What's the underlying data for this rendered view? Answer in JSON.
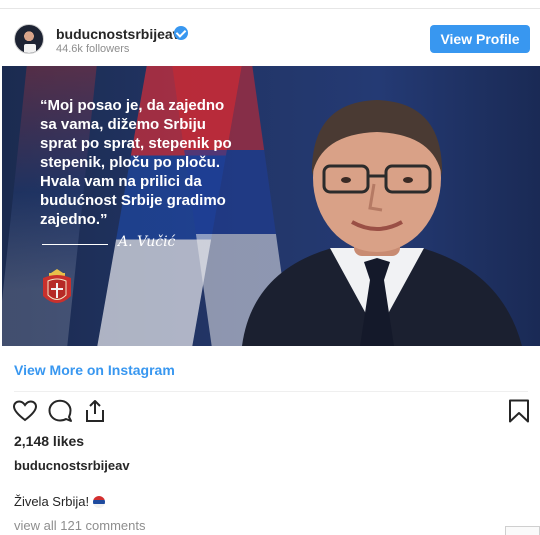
{
  "header": {
    "username": "buducnostsrbijeav",
    "followers": "44.6k followers",
    "view_profile_label": "View Profile",
    "verified_color": "#3897f0"
  },
  "post": {
    "quote_lines": [
      "“Moj posao je, da zajedno",
      "sa vama, dižemo Srbiju",
      "sprat po sprat, stepenik po",
      "stepenik, ploču po ploču.",
      "Hvala vam na prilici da",
      "budućnost Srbije gradimo",
      "zajedno.”"
    ],
    "signature": "A. Vučić",
    "view_more_label": "View More on Instagram",
    "likes": "2,148 likes",
    "caption_user": "buducnostsrbijeav",
    "caption_text": "Živela Srbija!",
    "comments_link": "view all 121 comments"
  },
  "icons": {
    "heart": "heart-icon",
    "comment": "comment-icon",
    "share": "share-icon",
    "bookmark": "bookmark-icon",
    "emoji": "serbia-flag-emoji"
  },
  "colors": {
    "accent": "#3897f0",
    "text": "#262626",
    "muted": "#8e8e8e"
  }
}
